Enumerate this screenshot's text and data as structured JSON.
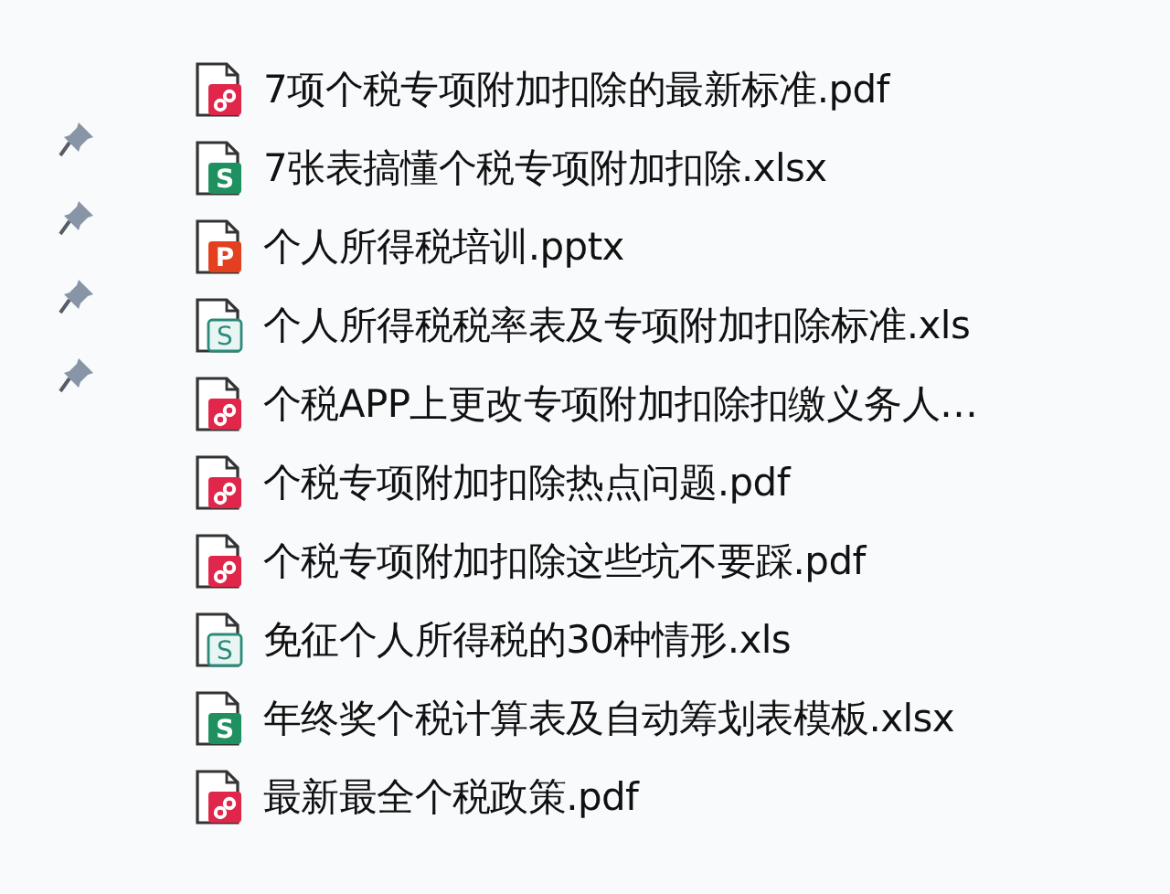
{
  "files": [
    {
      "name": "7项个税专项附加扣除的最新标准.pdf",
      "kind": "pdf",
      "pinned": false
    },
    {
      "name": "7张表搞懂个税专项附加扣除.xlsx",
      "kind": "xlsx",
      "icon_letter": "S",
      "pinned": true
    },
    {
      "name": "个人所得税培训.pptx",
      "kind": "pptx",
      "icon_letter": "P",
      "pinned": true
    },
    {
      "name": "个人所得税税率表及专项附加扣除标准.xls",
      "kind": "xls",
      "icon_letter": "S",
      "pinned": true
    },
    {
      "name": "个税APP上更改专项附加扣除扣缴义务人…",
      "kind": "pdf",
      "pinned": true
    },
    {
      "name": "个税专项附加扣除热点问题.pdf",
      "kind": "pdf",
      "pinned": false
    },
    {
      "name": "个税专项附加扣除这些坑不要踩.pdf",
      "kind": "pdf",
      "pinned": false
    },
    {
      "name": "免征个人所得税的30种情形.xls",
      "kind": "xls",
      "icon_letter": "S",
      "pinned": false
    },
    {
      "name": "年终奖个税计算表及自动筹划表模板.xlsx",
      "kind": "xlsx",
      "icon_letter": "S",
      "pinned": false
    },
    {
      "name": "最新最全个税政策.pdf",
      "kind": "pdf",
      "pinned": false
    }
  ]
}
